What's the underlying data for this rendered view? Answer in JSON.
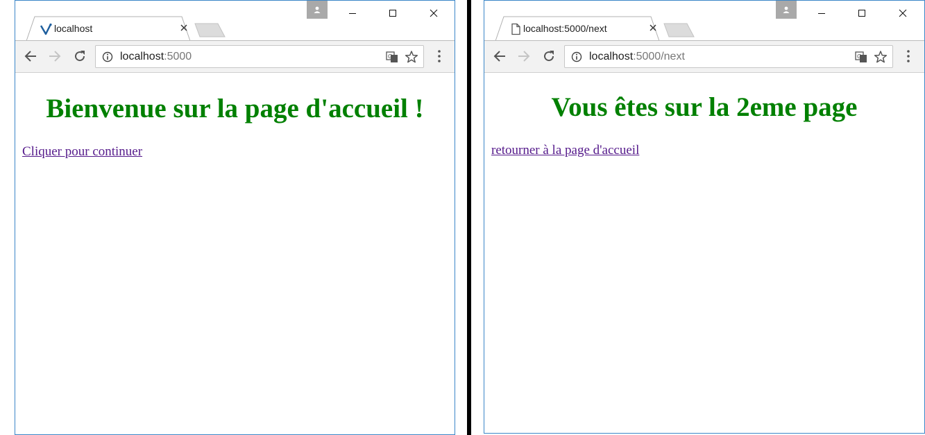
{
  "windows": [
    {
      "tab": {
        "title": "localhost",
        "favicon": "vivaldi-v-icon"
      },
      "url": {
        "host": "localhost",
        "rest": ":5000"
      },
      "page": {
        "heading": "Bienvenue sur la page d'accueil !",
        "link_text": "Cliquer pour continuer"
      }
    },
    {
      "tab": {
        "title": "localhost:5000/next",
        "favicon": "page-icon"
      },
      "url": {
        "host": "localhost",
        "rest": ":5000/next"
      },
      "page": {
        "heading": "Vous êtes sur la 2eme page",
        "link_text": "retourner à la page d'accueil"
      }
    }
  ],
  "colors": {
    "heading": "#008000",
    "visited_link": "#551a8b",
    "window_border": "#3a86c8",
    "toolbar": "#f2f2f2",
    "divider": "#000000"
  }
}
